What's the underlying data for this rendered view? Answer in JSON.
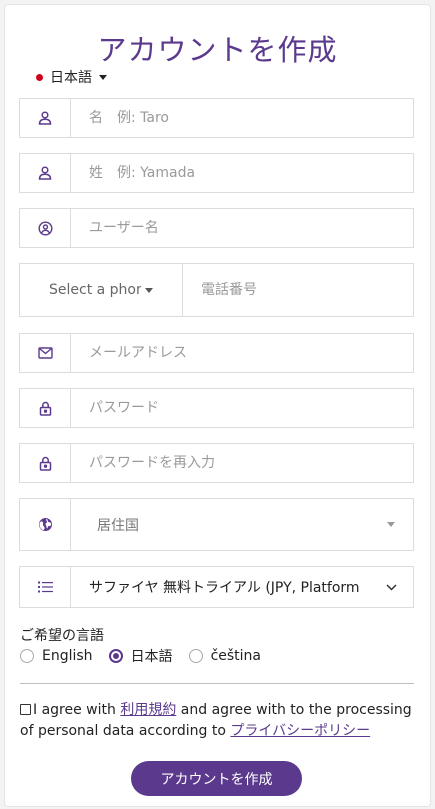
{
  "title": "アカウントを作成",
  "language_switcher": {
    "label": "日本語"
  },
  "fields": {
    "first_name": {
      "placeholder": "名　例: Taro",
      "icon": "user-icon"
    },
    "last_name": {
      "placeholder": "姓　例: Yamada",
      "icon": "user-icon"
    },
    "username": {
      "placeholder": "ユーザー名",
      "icon": "user-circle-icon"
    },
    "phone_country": {
      "placeholder": "Select a phone"
    },
    "phone_number": {
      "placeholder": "電話番号"
    },
    "email": {
      "placeholder": "メールアドレス",
      "icon": "envelope-icon"
    },
    "password": {
      "placeholder": "パスワード",
      "icon": "lock-icon"
    },
    "password_confirm": {
      "placeholder": "パスワードを再入力",
      "icon": "lock-icon"
    },
    "country": {
      "placeholder": "居住国",
      "icon": "globe-icon"
    },
    "plan": {
      "value": "サファイヤ 無料トライアル (JPY, Platform",
      "icon": "list-icon"
    }
  },
  "preferred_language": {
    "label": "ご希望の言語",
    "options": [
      "English",
      "日本語",
      "čeština"
    ],
    "selected": "日本語"
  },
  "agreement": {
    "prefix": "I agree with ",
    "terms_link": "利用規約",
    "middle": " and agree with to the processing of personal data according to ",
    "privacy_link": "プライバシーポリシー"
  },
  "submit_label": "アカウントを作成",
  "colors": {
    "accent": "#5b3a8e"
  }
}
